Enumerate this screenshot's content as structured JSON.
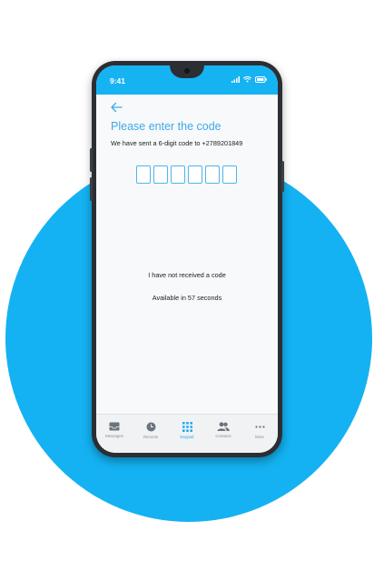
{
  "status": {
    "time": "9:41"
  },
  "header": {
    "title": "Please enter the code"
  },
  "verification": {
    "instruction": "We have sent a 6-digit code to +2789201849",
    "code_digits": [
      "",
      "",
      "",
      "",
      "",
      ""
    ],
    "not_received": "I have not received a code",
    "available": "Available in 57 seconds"
  },
  "tabs": [
    {
      "label": "Messages",
      "icon": "messages-icon",
      "active": false
    },
    {
      "label": "Recents",
      "icon": "clock-icon",
      "active": false
    },
    {
      "label": "Keypad",
      "icon": "keypad-icon",
      "active": true
    },
    {
      "label": "Contacts",
      "icon": "contacts-icon",
      "active": false
    },
    {
      "label": "More",
      "icon": "more-icon",
      "active": false
    }
  ],
  "colors": {
    "accent": "#16b3f3",
    "title": "#3fa9e9",
    "phone_body": "#2b2f33",
    "active_tab": "#1ea9ee"
  }
}
